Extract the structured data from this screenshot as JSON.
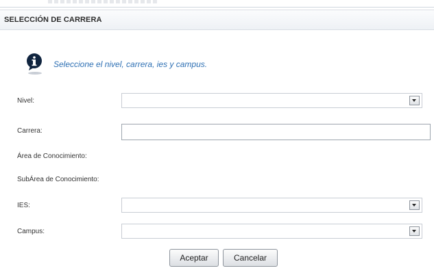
{
  "dialog": {
    "title": "SELECCIÓN DE CARRERA",
    "info_message": "Seleccione el nivel, carrera, ies y campus."
  },
  "form": {
    "nivel_label": "Nivel:",
    "nivel_value": "",
    "carrera_label": "Carrera:",
    "carrera_value": "",
    "area_label": "Área de Conocimiento:",
    "subarea_label": "SubÁrea de Conocimiento:",
    "ies_label": "IES:",
    "ies_value": "",
    "campus_label": "Campus:",
    "campus_value": ""
  },
  "buttons": {
    "accept_label": "Aceptar",
    "cancel_label": "Cancelar"
  },
  "icons": {
    "info": "info-icon",
    "dropdown": "chevron-down-icon"
  },
  "colors": {
    "info_text": "#2d6fb3",
    "info_icon": "#10243f"
  }
}
